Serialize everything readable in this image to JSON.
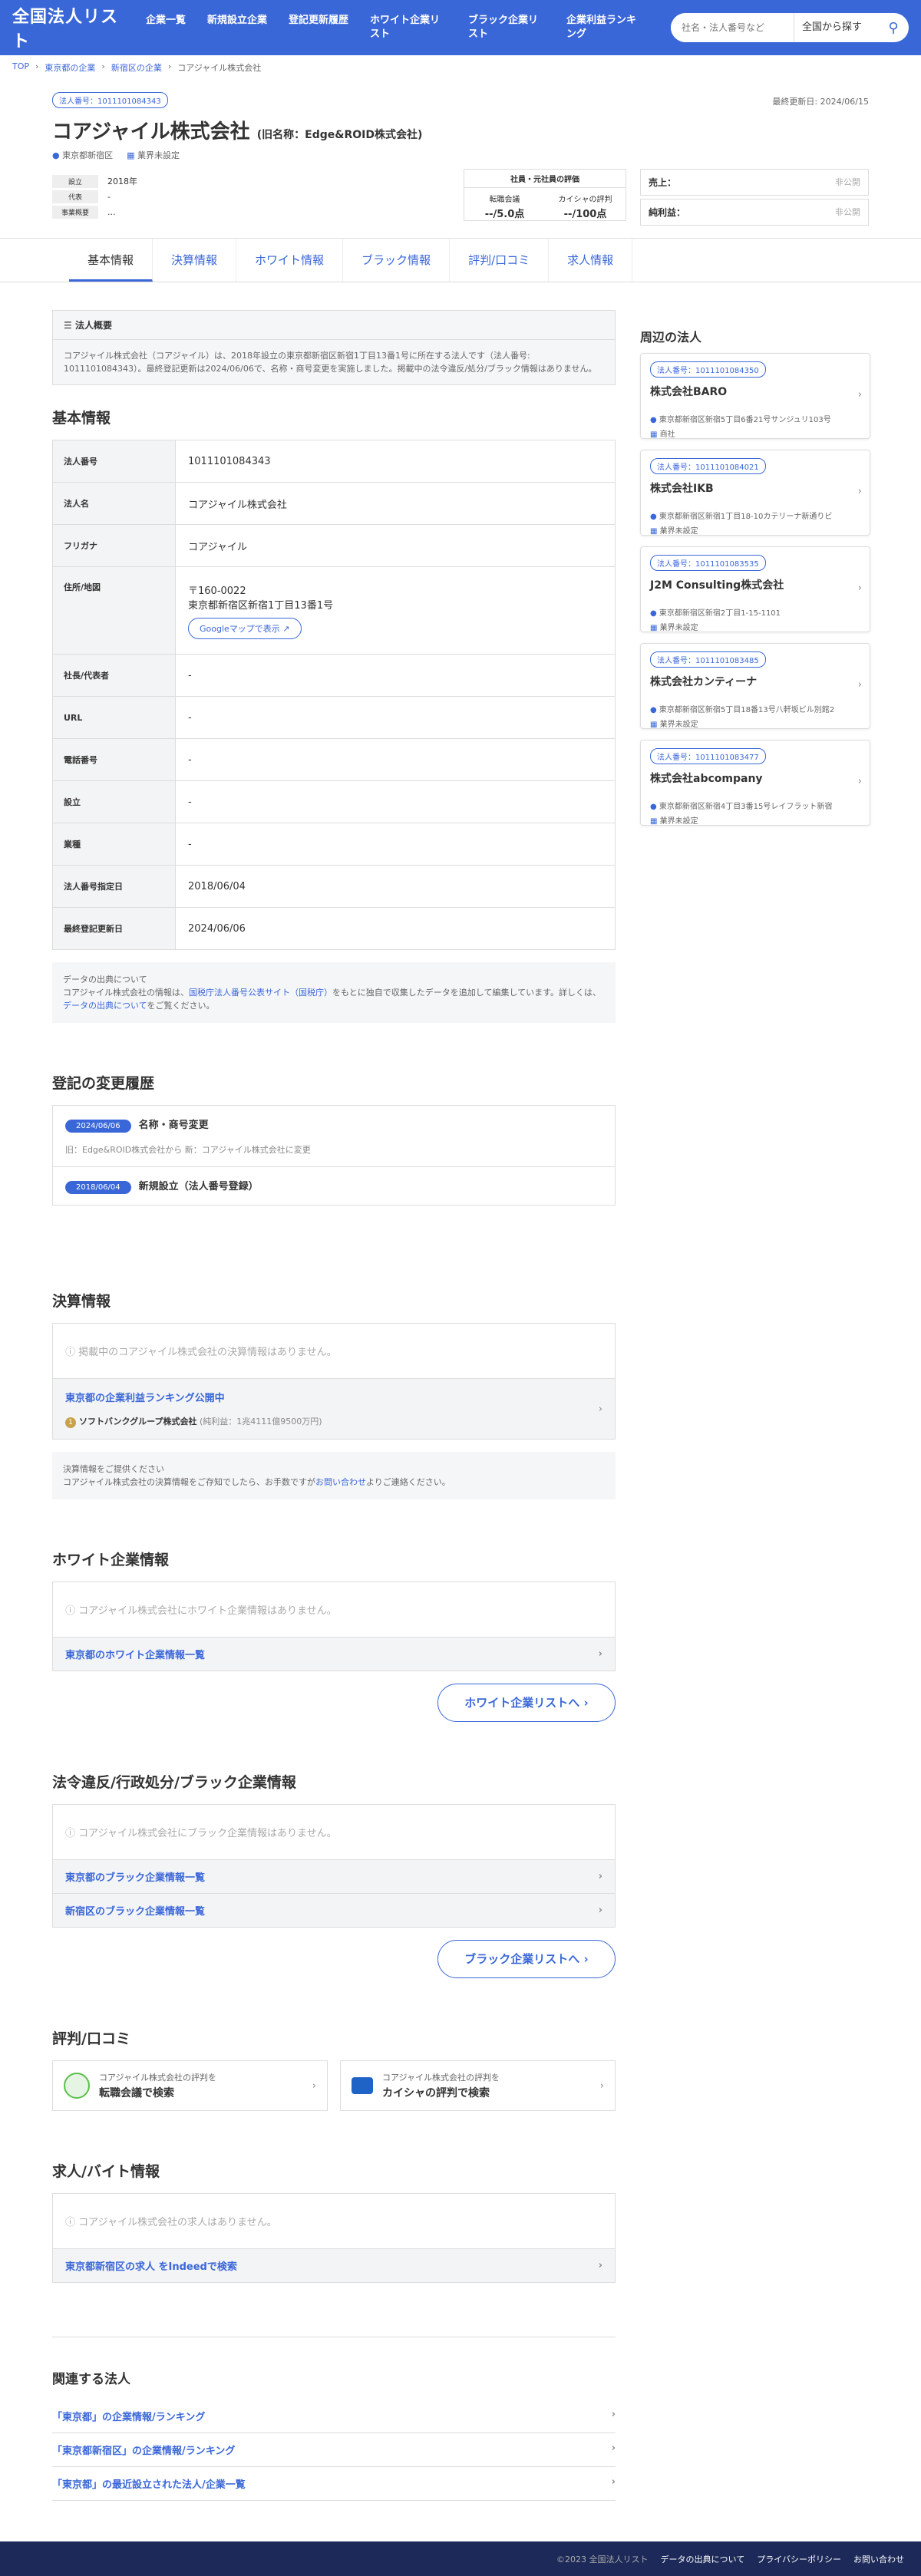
{
  "header": {
    "logo": "全国法人リスト",
    "nav": [
      "企業一覧",
      "新規設立企業",
      "登記更新履歴",
      "ホワイト企業リスト",
      "ブラック企業リスト",
      "企業利益ランキング"
    ],
    "search_placeholder": "社名・法人番号など",
    "search_scope": "全国から探す"
  },
  "breadcrumb": [
    "TOP",
    "東京都の企業",
    "新宿区の企業",
    "コアジャイル株式会社"
  ],
  "company": {
    "number_badge": "法人番号：1011101084343",
    "updated": "最終更新日: 2024/06/15",
    "name": "コアジャイル株式会社",
    "old_name": "(旧名称：Edge&ROID株式会社)",
    "location": "東京都新宿区",
    "industry": "業界未設定",
    "facts": [
      {
        "label": "設立",
        "value": "2018年"
      },
      {
        "label": "代表",
        "value": "-"
      },
      {
        "label": "事業概要",
        "value": "..."
      }
    ],
    "eval_title": "社員・元社員の評価",
    "eval": [
      {
        "label": "転職会議",
        "value": "--/5.0点"
      },
      {
        "label": "カイシャの評判",
        "value": "--/100点"
      }
    ],
    "sales_label": "売上：",
    "sales": "非公開",
    "profit_label": "純利益：",
    "profit": "非公開"
  },
  "tabs": [
    "基本情報",
    "決算情報",
    "ホワイト情報",
    "ブラック情報",
    "評判/口コミ",
    "求人情報"
  ],
  "summary": {
    "title": "法人概要",
    "text": "コアジャイル株式会社（コアジャイル）は、2018年設立の東京都新宿区新宿1丁目13番1号に所在する法人です（法人番号: 1011101084343）。最終登記更新は2024/06/06で、名称・商号変更を実施しました。掲載中の法令違反/処分/ブラック情報はありません。"
  },
  "basic": {
    "title": "基本情報",
    "rows": [
      {
        "label": "法人番号",
        "value": "1011101084343"
      },
      {
        "label": "法人名",
        "value": "コアジャイル株式会社"
      },
      {
        "label": "フリガナ",
        "value": "コアジャイル"
      },
      {
        "label": "住所/地図",
        "value": "〒160-0022",
        "value2": "東京都新宿区新宿1丁目13番1号",
        "map": "Googleマップで表示"
      },
      {
        "label": "社長/代表者",
        "value": "-"
      },
      {
        "label": "URL",
        "value": "-"
      },
      {
        "label": "電話番号",
        "value": "-"
      },
      {
        "label": "設立",
        "value": "-"
      },
      {
        "label": "業種",
        "value": "-"
      },
      {
        "label": "法人番号指定日",
        "value": "2018/06/04"
      },
      {
        "label": "最終登記更新日",
        "value": "2024/06/06"
      }
    ]
  },
  "source": {
    "title": "データの出典について",
    "text1": "コアジャイル株式会社の情報は、",
    "link1": "国税庁法人番号公表サイト（国税庁）",
    "text2": "をもとに独自で収集したデータを追加して編集しています。詳しくは、",
    "link2": "データの出典について",
    "text3": "をご覧ください。"
  },
  "history": {
    "title": "登記の変更履歴",
    "items": [
      {
        "date": "2024/06/06",
        "event": "名称・商号変更",
        "detail": "旧：Edge&ROID株式会社から 新：コアジャイル株式会社に変更"
      },
      {
        "date": "2018/06/04",
        "event": "新規設立（法人番号登録）",
        "detail": ""
      }
    ]
  },
  "finance": {
    "title": "決算情報",
    "empty": "掲載中のコアジャイル株式会社の決算情報はありません。",
    "rank_title": "東京都の企業利益ランキング公開中",
    "rank_company": "ソフトバンクグループ株式会社",
    "rank_profit": "(純利益：1兆4111億9500万円)",
    "note_title": "決算情報をご提供ください",
    "note_text1": "コアジャイル株式会社の決算情報をご存知でしたら、お手数ですが",
    "note_link": "お問い合わせ",
    "note_text2": "よりご連絡ください。"
  },
  "white": {
    "title": "ホワイト企業情報",
    "empty": "コアジャイル株式会社にホワイト企業情報はありません。",
    "link": "東京都のホワイト企業情報一覧",
    "button": "ホワイト企業リストへ"
  },
  "black": {
    "title": "法令違反/行政処分/ブラック企業情報",
    "empty": "コアジャイル株式会社にブラック企業情報はありません。",
    "links": [
      "東京都のブラック企業情報一覧",
      "新宿区のブラック企業情報一覧"
    ],
    "button": "ブラック企業リストへ"
  },
  "reviews": {
    "title": "評判/口コミ",
    "items": [
      {
        "top": "コアジャイル株式会社の評判を",
        "bottom": "転職会議で検索"
      },
      {
        "top": "コアジャイル株式会社の評判を",
        "bottom": "カイシャの評判で検索"
      }
    ]
  },
  "jobs": {
    "title": "求人/バイト情報",
    "empty": "コアジャイル株式会社の求人はありません。",
    "link": "東京都新宿区の求人 をIndeedで検索"
  },
  "related": {
    "title": "関連する法人",
    "links": [
      "「東京都」の企業情報/ランキング",
      "「東京都新宿区」の企業情報/ランキング",
      "「東京都」の最近設立された法人/企業一覧"
    ]
  },
  "nearby": {
    "title": "周辺の法人",
    "items": [
      {
        "num": "法人番号：1011101084350",
        "name": "株式会社BARO",
        "addr": "東京都新宿区新宿5丁目6番21号サンジュリ103号",
        "ind": "商社"
      },
      {
        "num": "法人番号：1011101084021",
        "name": "株式会社IKB",
        "addr": "東京都新宿区新宿1丁目18-10カテリーナ新通りビ",
        "ind": "業界未設定"
      },
      {
        "num": "法人番号：1011101083535",
        "name": "J2M Consulting株式会社",
        "addr": "東京都新宿区新宿2丁目1-15-1101",
        "ind": "業界未設定"
      },
      {
        "num": "法人番号：1011101083485",
        "name": "株式会社カンティーナ",
        "addr": "東京都新宿区新宿5丁目18番13号八軒坂ビル別館2",
        "ind": "業界未設定"
      },
      {
        "num": "法人番号：1011101083477",
        "name": "株式会社abcompany",
        "addr": "東京都新宿区新宿4丁目3番15号レイフラット新宿",
        "ind": "業界未設定"
      }
    ]
  },
  "footer": {
    "copy": "©2023 全国法人リスト",
    "links": [
      "データの出典について",
      "プライバシーポリシー",
      "お問い合わせ"
    ]
  },
  "colors": {
    "brand": "#3a67d8",
    "footer": "#1d2a59"
  }
}
